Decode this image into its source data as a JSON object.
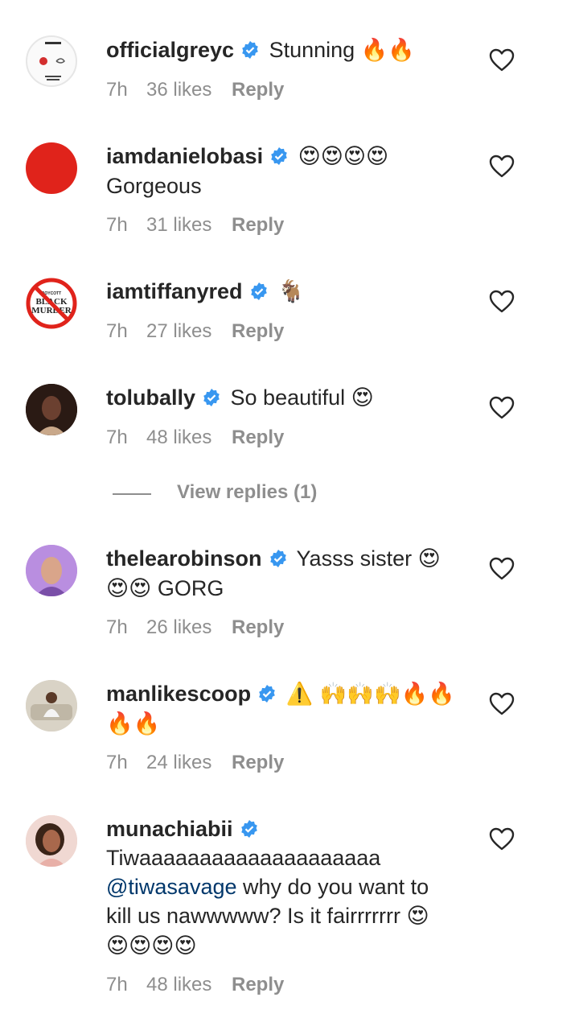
{
  "comments": [
    {
      "username": "officialgreyc",
      "text": "Stunning",
      "emoji": "🔥🔥",
      "time": "7h",
      "likes": "36 likes",
      "reply": "Reply"
    },
    {
      "username": "iamdanielobasi",
      "emoji": "😍😍😍😍",
      "text": "Gorgeous",
      "time": "7h",
      "likes": "31 likes",
      "reply": "Reply"
    },
    {
      "username": "iamtiffanyred",
      "emoji": "🐐",
      "time": "7h",
      "likes": "27 likes",
      "reply": "Reply",
      "avatar_text_small": "BOYCOTT",
      "avatar_text_1": "BLACK",
      "avatar_text_2": "MURDER"
    },
    {
      "username": "tolubally",
      "text": "So beautiful",
      "emoji": "😍",
      "time": "7h",
      "likes": "48 likes",
      "reply": "Reply"
    },
    {
      "username": "thelearobinson",
      "text": "Yasss sister",
      "emoji": "😍",
      "emoji2": "😍😍",
      "text2": "GORG",
      "time": "7h",
      "likes": "26 likes",
      "reply": "Reply"
    },
    {
      "username": "manlikescoop",
      "emoji": "⚠️ 🙌🙌🙌🔥🔥",
      "emoji2": "🔥🔥",
      "time": "7h",
      "likes": "24 likes",
      "reply": "Reply"
    },
    {
      "username": "munachiabii",
      "text": "Tiwaaaaaaaaaaaaaaaaaaaa",
      "mention": "@tiwasavage",
      "text2": "why do you want to kill us nawwwww? Is it fairrrrrrr",
      "emoji": "😍",
      "emoji2": "😍😍😍😍",
      "time": "7h",
      "likes": "48 likes",
      "reply": "Reply"
    }
  ],
  "view_replies": "View replies (1)",
  "colors": {
    "verified": "#3897f0",
    "meta": "#8e8e8e",
    "mention": "#00376b"
  },
  "icons": {
    "verified": "verified-badge-icon",
    "like": "heart-outline-icon"
  }
}
